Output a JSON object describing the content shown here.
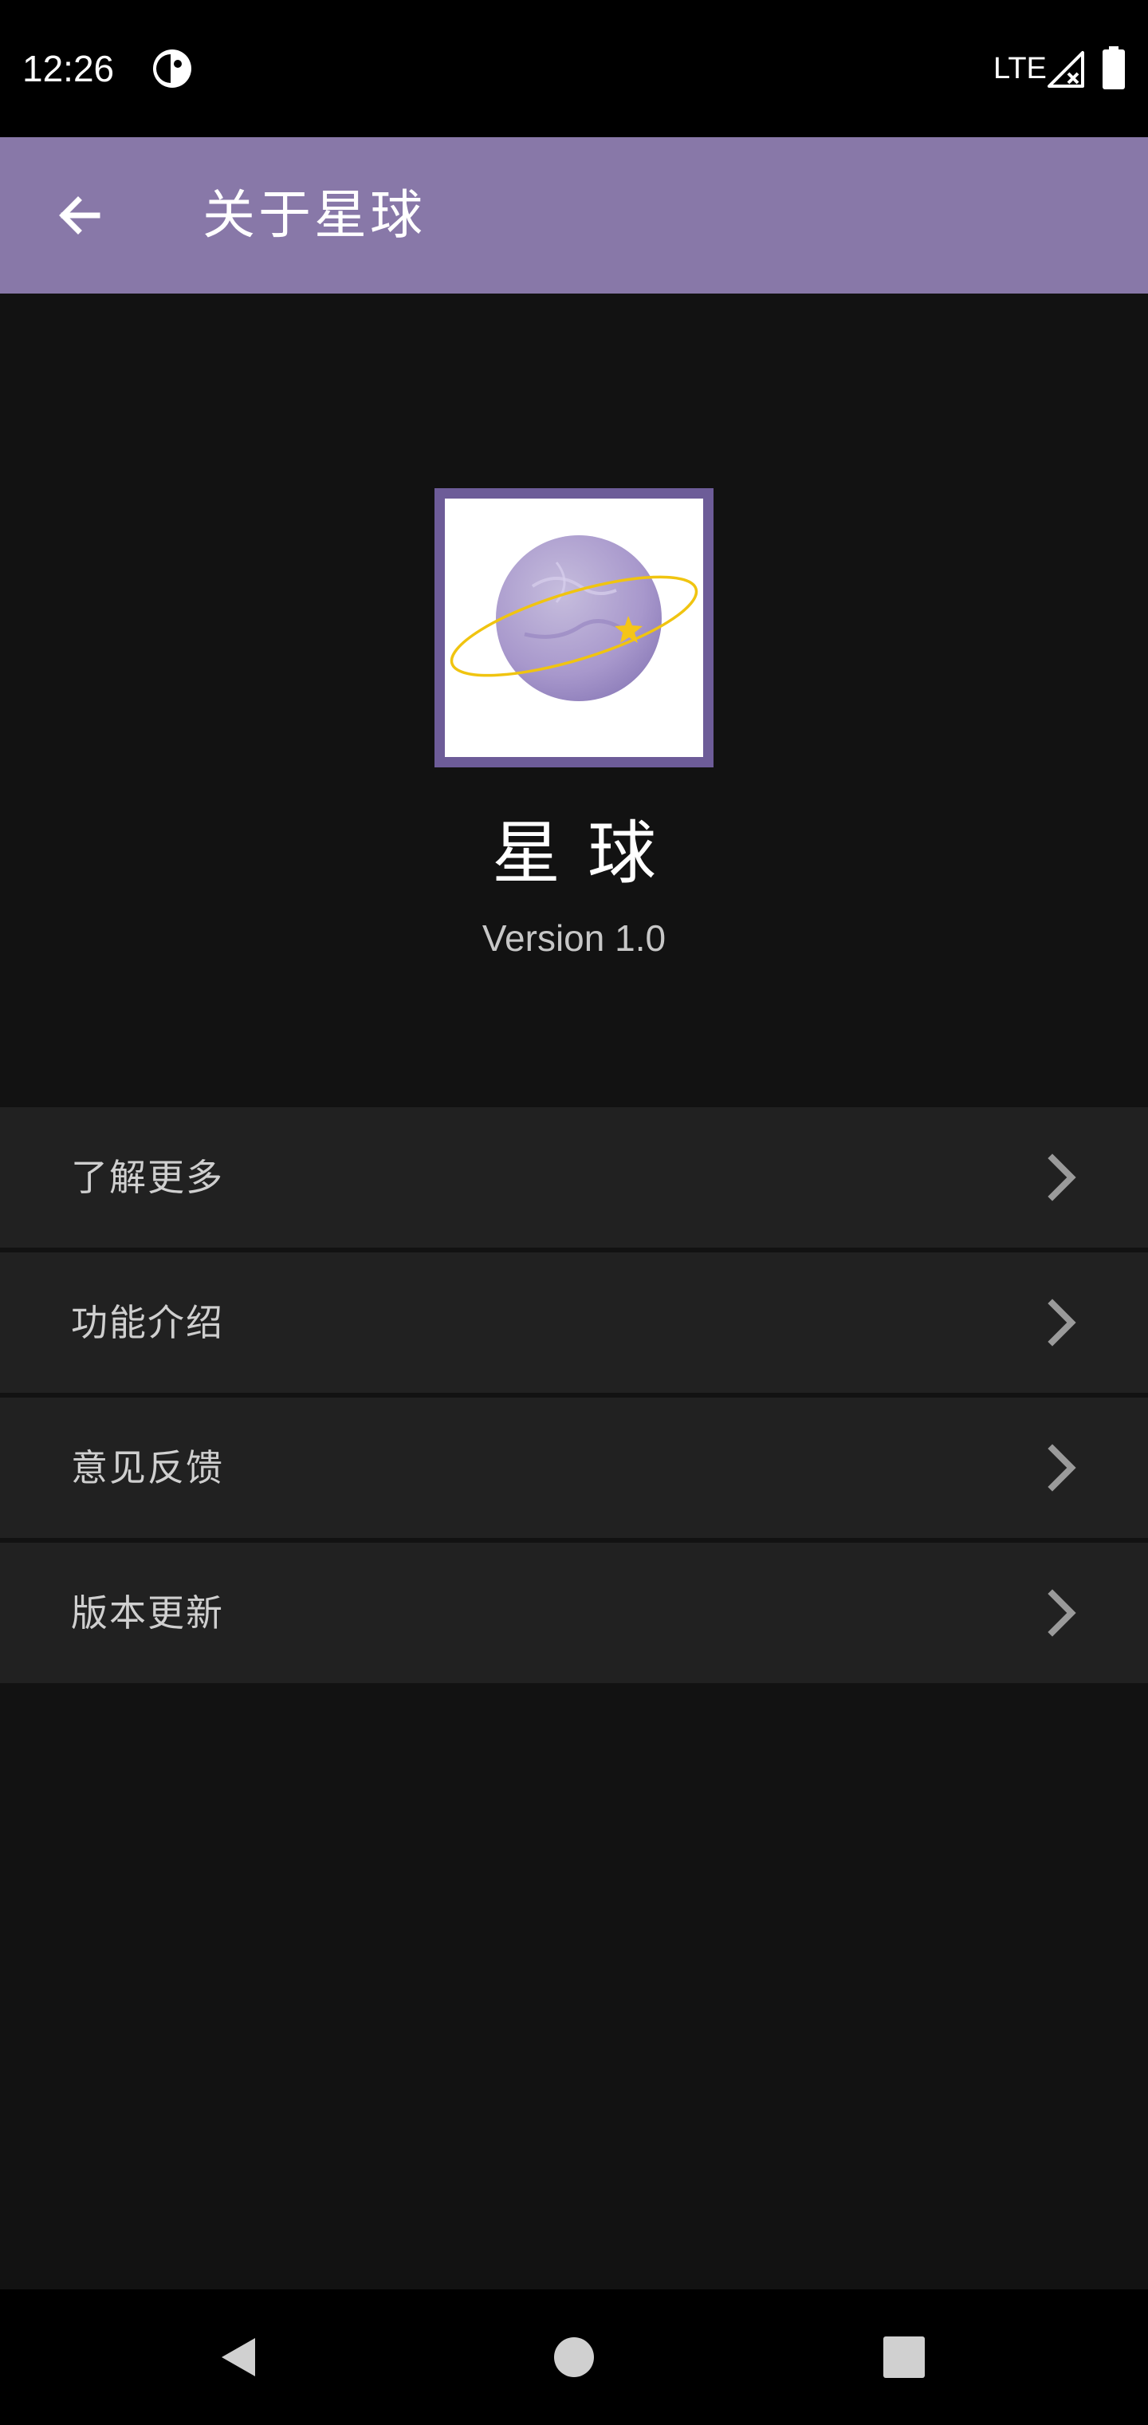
{
  "status_bar": {
    "time": "12:26",
    "network": "LTE",
    "icons": [
      "app-notification-icon",
      "signal-icon",
      "battery-icon"
    ]
  },
  "toolbar": {
    "title": "关于星球",
    "back_icon": "arrow-left-icon",
    "background": "#8878a8"
  },
  "app_info": {
    "name": "星球",
    "version": "Version 1.0",
    "logo_icon": "planet-logo-icon"
  },
  "menu": {
    "items": [
      {
        "label": "了解更多",
        "icon": "chevron-right-icon"
      },
      {
        "label": "功能介绍",
        "icon": "chevron-right-icon"
      },
      {
        "label": "意见反馈",
        "icon": "chevron-right-icon"
      },
      {
        "label": "版本更新",
        "icon": "chevron-right-icon"
      }
    ]
  },
  "nav_bar": {
    "buttons": [
      "nav-back-icon",
      "nav-home-icon",
      "nav-recents-icon"
    ]
  },
  "colors": {
    "accent": "#8878a8",
    "logo_border": "#6d5c98",
    "background": "#121212",
    "menu_item": "#212121"
  }
}
